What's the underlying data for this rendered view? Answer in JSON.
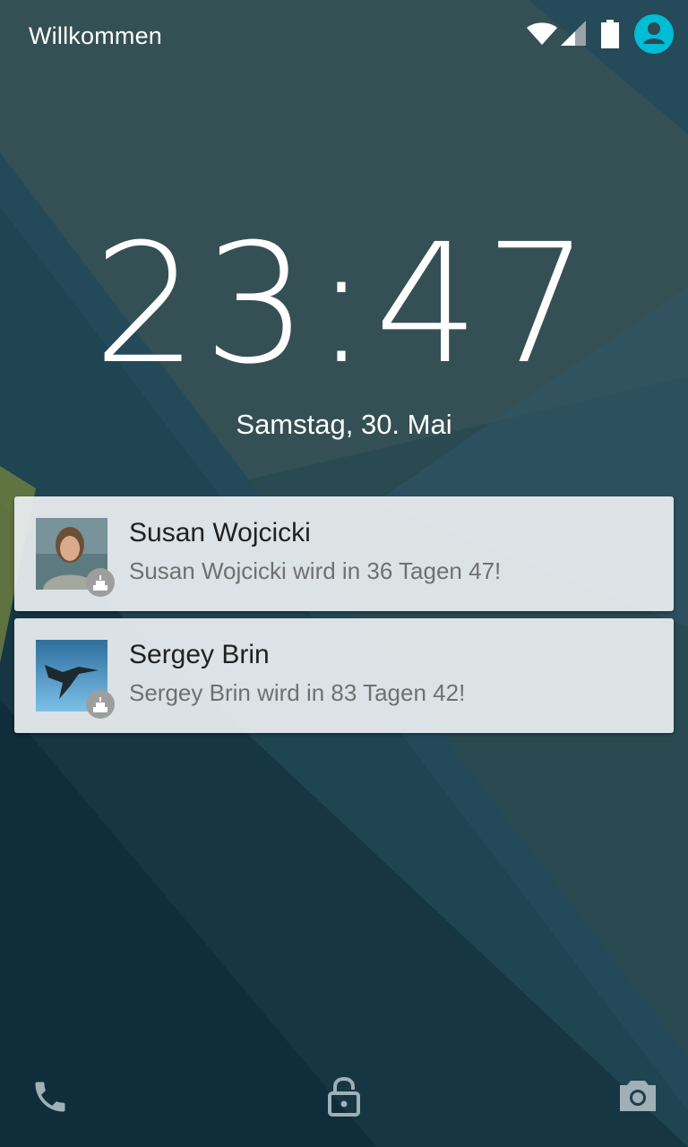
{
  "status_bar": {
    "carrier": "Willkommen",
    "icons": [
      "wifi-icon",
      "cell-signal-icon",
      "battery-icon",
      "user-avatar-icon"
    ]
  },
  "lockscreen": {
    "time": "23:47",
    "date": "Samstag, 30. Mai"
  },
  "notifications": [
    {
      "title": "Susan Wojcicki",
      "text": "Susan Wojcicki wird in 36 Tagen 47!",
      "small_icon": "cake-icon"
    },
    {
      "title": "Sergey Brin",
      "text": "Sergey Brin wird in 83 Tagen 42!",
      "small_icon": "cake-icon"
    }
  ],
  "bottom_actions": [
    "phone-icon",
    "unlock-icon",
    "camera-icon"
  ],
  "colors": {
    "accent": "#00BCD4",
    "notification_bg": "#EDF0F2",
    "title_text": "#212121",
    "body_text": "#707070"
  }
}
